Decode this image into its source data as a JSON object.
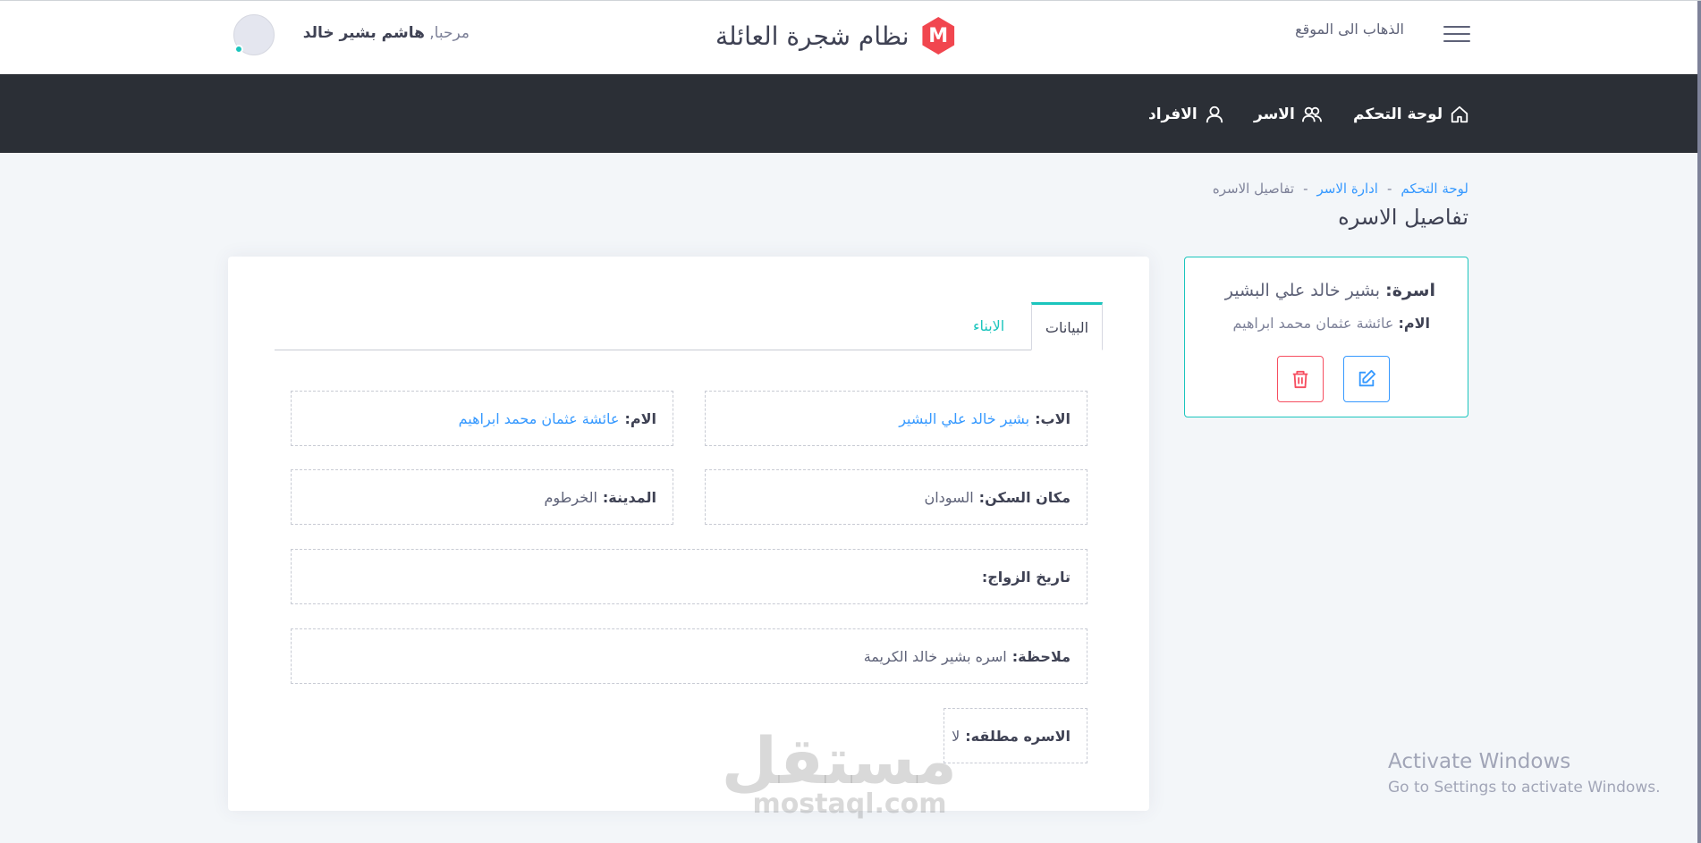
{
  "header": {
    "goto_site": "الذهاب الى الموقع",
    "brand_logo_letter": "M",
    "brand_title": "نظام شجرة العائلة",
    "greeting": "مرحبا,",
    "user_name": "هاشم بشير خالد",
    "brand_color": "#f1464f"
  },
  "nav": {
    "dashboard": "لوحة التحكم",
    "families": "الاسر",
    "members": "الافراد",
    "dashboard_icon": "home-icon",
    "families_icon": "users-icon",
    "members_icon": "user-icon"
  },
  "breadcrumb": {
    "item1": "لوحة التحكم",
    "item2": "ادارة الاسر",
    "item3": "تفاصيل الاسره",
    "separator": "-"
  },
  "page_title": "تفاصيل الاسره",
  "family_card": {
    "family_label": "اسرة:",
    "family_value": "بشير خالد علي البشير",
    "mother_label": "الام:",
    "mother_value": "عائشة عثمان محمد ابراهيم",
    "edit_icon": "edit-icon",
    "delete_icon": "trash-icon"
  },
  "tabs": {
    "data": "البيانات",
    "children": "الابناء"
  },
  "details": {
    "father_label": "الاب:",
    "father_value": "بشير خالد علي البشير",
    "mother_label": "الام:",
    "mother_value": "عائشة عثمان محمد ابراهيم",
    "residence_label": "مكان السكن:",
    "residence_value": "السودان",
    "city_label": "المدينة:",
    "city_value": "الخرطوم",
    "marriage_date_label": "تاريخ الزواج:",
    "marriage_date_value": "",
    "note_label": "ملاحظة:",
    "note_value": "اسره بشير خالد الكريمة",
    "divorced_label": "الاسره مطلقه:",
    "divorced_value": "لا"
  },
  "watermark": {
    "arabic": "مستقل",
    "latin": "mostaql.com"
  },
  "activation": {
    "title": "Activate Windows",
    "subtitle": "Go to Settings to activate Windows."
  }
}
